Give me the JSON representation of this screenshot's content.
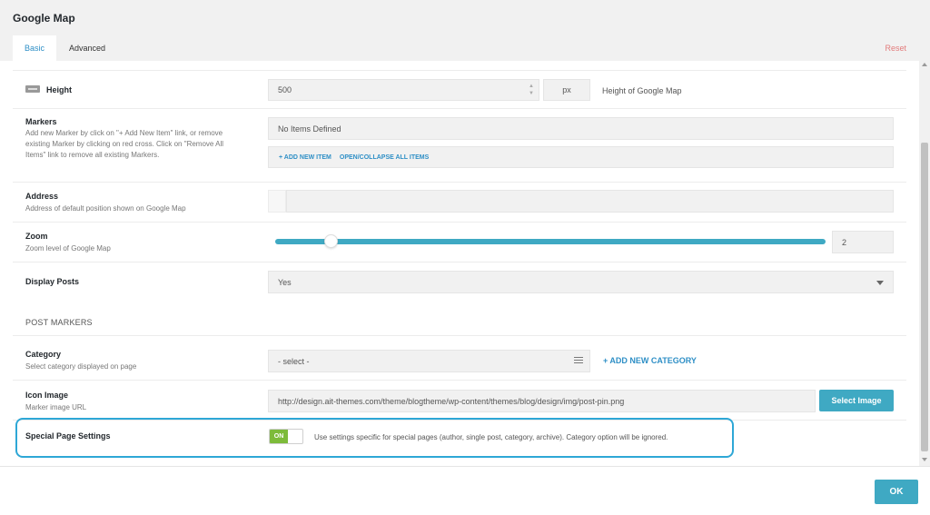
{
  "dialog": {
    "title": "Google Map"
  },
  "tabs": [
    {
      "label": "Basic",
      "active": true
    },
    {
      "label": "Advanced",
      "active": false
    }
  ],
  "reset_label": "Reset",
  "height": {
    "label": "Height",
    "value": "500",
    "unit": "px",
    "hint": "Height of Google Map"
  },
  "markers": {
    "label": "Markers",
    "description": "Add new Marker by click on \"+ Add New Item\" link, or remove existing Marker by clicking on red cross. Click on \"Remove All Items\" link to remove all existing Markers.",
    "empty_text": "No Items Defined",
    "add_link": "+ ADD NEW ITEM",
    "collapse_link": "OPEN/COLLAPSE ALL ITEMS"
  },
  "address": {
    "label": "Address",
    "description": "Address of default position shown on Google Map",
    "value": ""
  },
  "zoom": {
    "label": "Zoom",
    "description": "Zoom level of Google Map",
    "value": "2"
  },
  "display_posts": {
    "label": "Display Posts",
    "selected": "Yes"
  },
  "post_markers": {
    "heading": "POST MARKERS"
  },
  "category": {
    "label": "Category",
    "description": "Select category displayed on page",
    "selected": "- select -",
    "add_link": "+ ADD NEW CATEGORY"
  },
  "icon_image": {
    "label": "Icon Image",
    "description": "Marker image URL",
    "value": "http://design.ait-themes.com/theme/blogtheme/wp-content/themes/blog/design/img/post-pin.png",
    "button": "Select Image"
  },
  "special_page": {
    "label": "Special Page Settings",
    "toggle": "ON",
    "description": "Use settings specific for special pages (author, single post, category, archive). Category option will be ignored."
  },
  "footer": {
    "ok_label": "OK"
  },
  "colors": {
    "accent": "#3fa9c3",
    "link": "#2e8fc6",
    "toggle_on": "#7dbb3a",
    "reset": "#e27c7c",
    "highlight": "#2ea7d6"
  }
}
